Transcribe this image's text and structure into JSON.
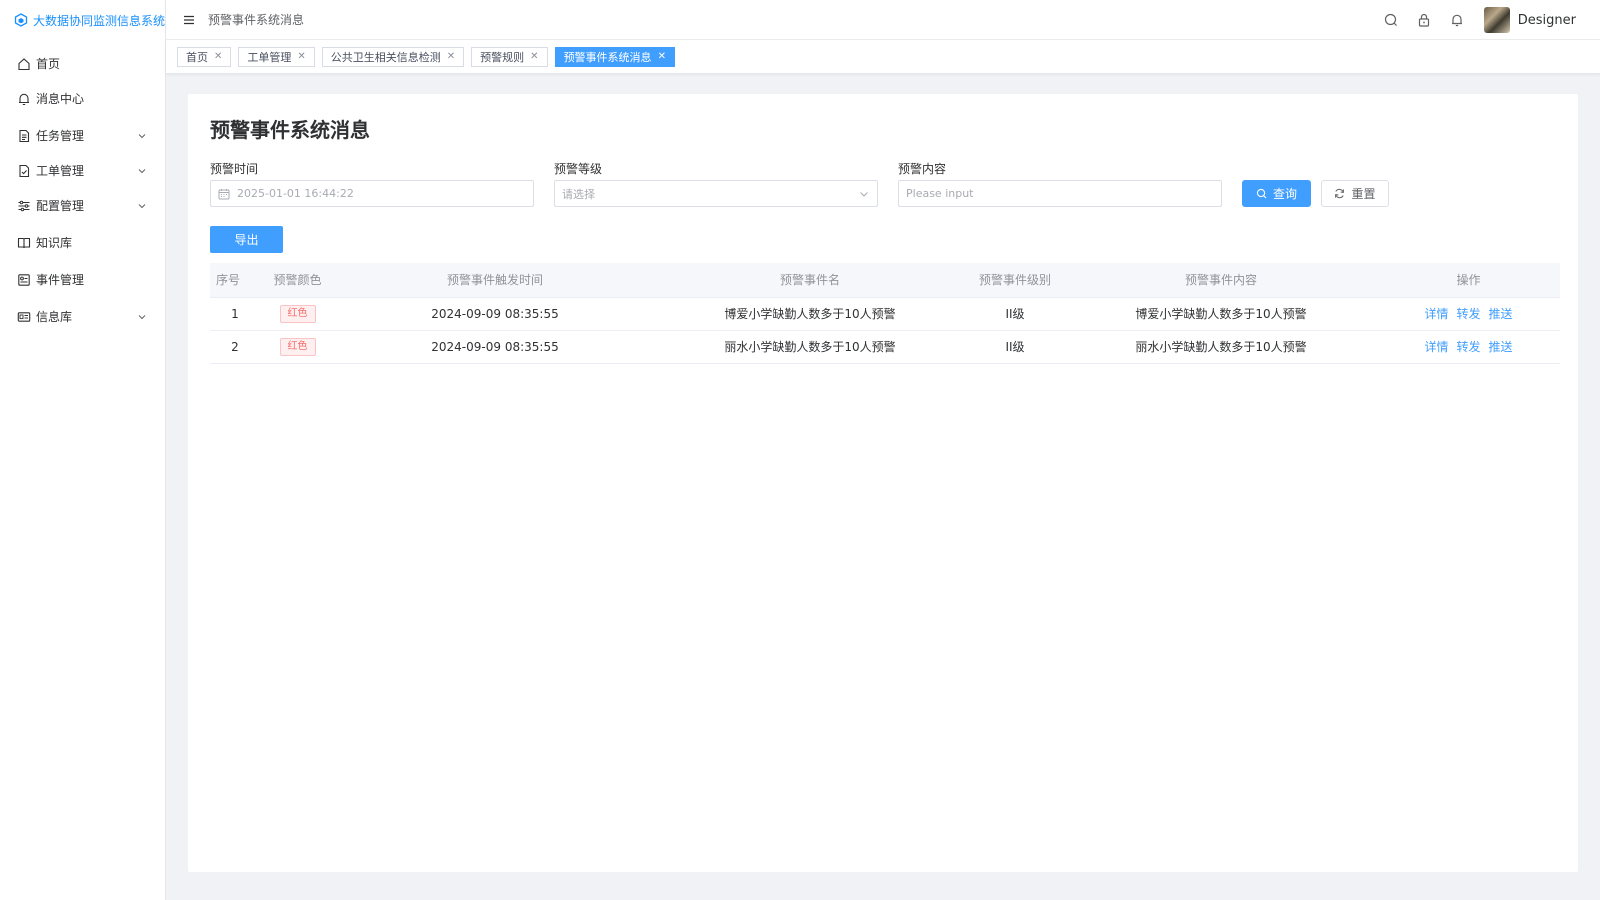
{
  "app": {
    "title": "大数据协同监测信息系统"
  },
  "sidebar": {
    "items": [
      {
        "label": "首页",
        "icon": "home-icon"
      },
      {
        "label": "消息中心",
        "icon": "bell-icon"
      },
      {
        "label": "任务管理",
        "icon": "document-icon",
        "expandable": true
      },
      {
        "label": "工单管理",
        "icon": "file-check-icon",
        "expandable": true
      },
      {
        "label": "配置管理",
        "icon": "sliders-icon",
        "expandable": true
      },
      {
        "label": "知识库",
        "icon": "book-icon"
      },
      {
        "label": "事件管理",
        "icon": "event-icon"
      },
      {
        "label": "信息库",
        "icon": "id-card-icon",
        "expandable": true
      }
    ]
  },
  "header": {
    "breadcrumb": "预警事件系统消息",
    "username": "Designer"
  },
  "tabs": [
    {
      "label": "首页",
      "active": false
    },
    {
      "label": "工单管理",
      "active": false
    },
    {
      "label": "公共卫生相关信息检测",
      "active": false
    },
    {
      "label": "预警规则",
      "active": false
    },
    {
      "label": "预警事件系统消息",
      "active": true
    }
  ],
  "page": {
    "title": "预警事件系统消息",
    "filters": {
      "time": {
        "label": "预警时间",
        "placeholder": "2025-01-01 16:44:22"
      },
      "level": {
        "label": "预警等级",
        "placeholder": "请选择"
      },
      "content": {
        "label": "预警内容",
        "placeholder": "Please input"
      }
    },
    "buttons": {
      "query": "查询",
      "reset": "重置",
      "export": "导出"
    },
    "table": {
      "columns": [
        "序号",
        "预警颜色",
        "预警事件触发时间",
        "预警事件名",
        "预警事件级别",
        "预警事件内容",
        "操作"
      ],
      "rows": [
        {
          "index": "1",
          "color": "红色",
          "time": "2024-09-09 08:35:55",
          "name": "博爱小学缺勤人数多于10人预警",
          "level": "II级",
          "content": "博爱小学缺勤人数多于10人预警"
        },
        {
          "index": "2",
          "color": "红色",
          "time": "2024-09-09 08:35:55",
          "name": "丽水小学缺勤人数多于10人预警",
          "level": "II级",
          "content": "丽水小学缺勤人数多于10人预警"
        }
      ],
      "actions": [
        "详情",
        "转发",
        "推送"
      ]
    }
  },
  "colors": {
    "primary": "#409eff",
    "danger": "#f56c6c",
    "logo": "#1890ff"
  }
}
